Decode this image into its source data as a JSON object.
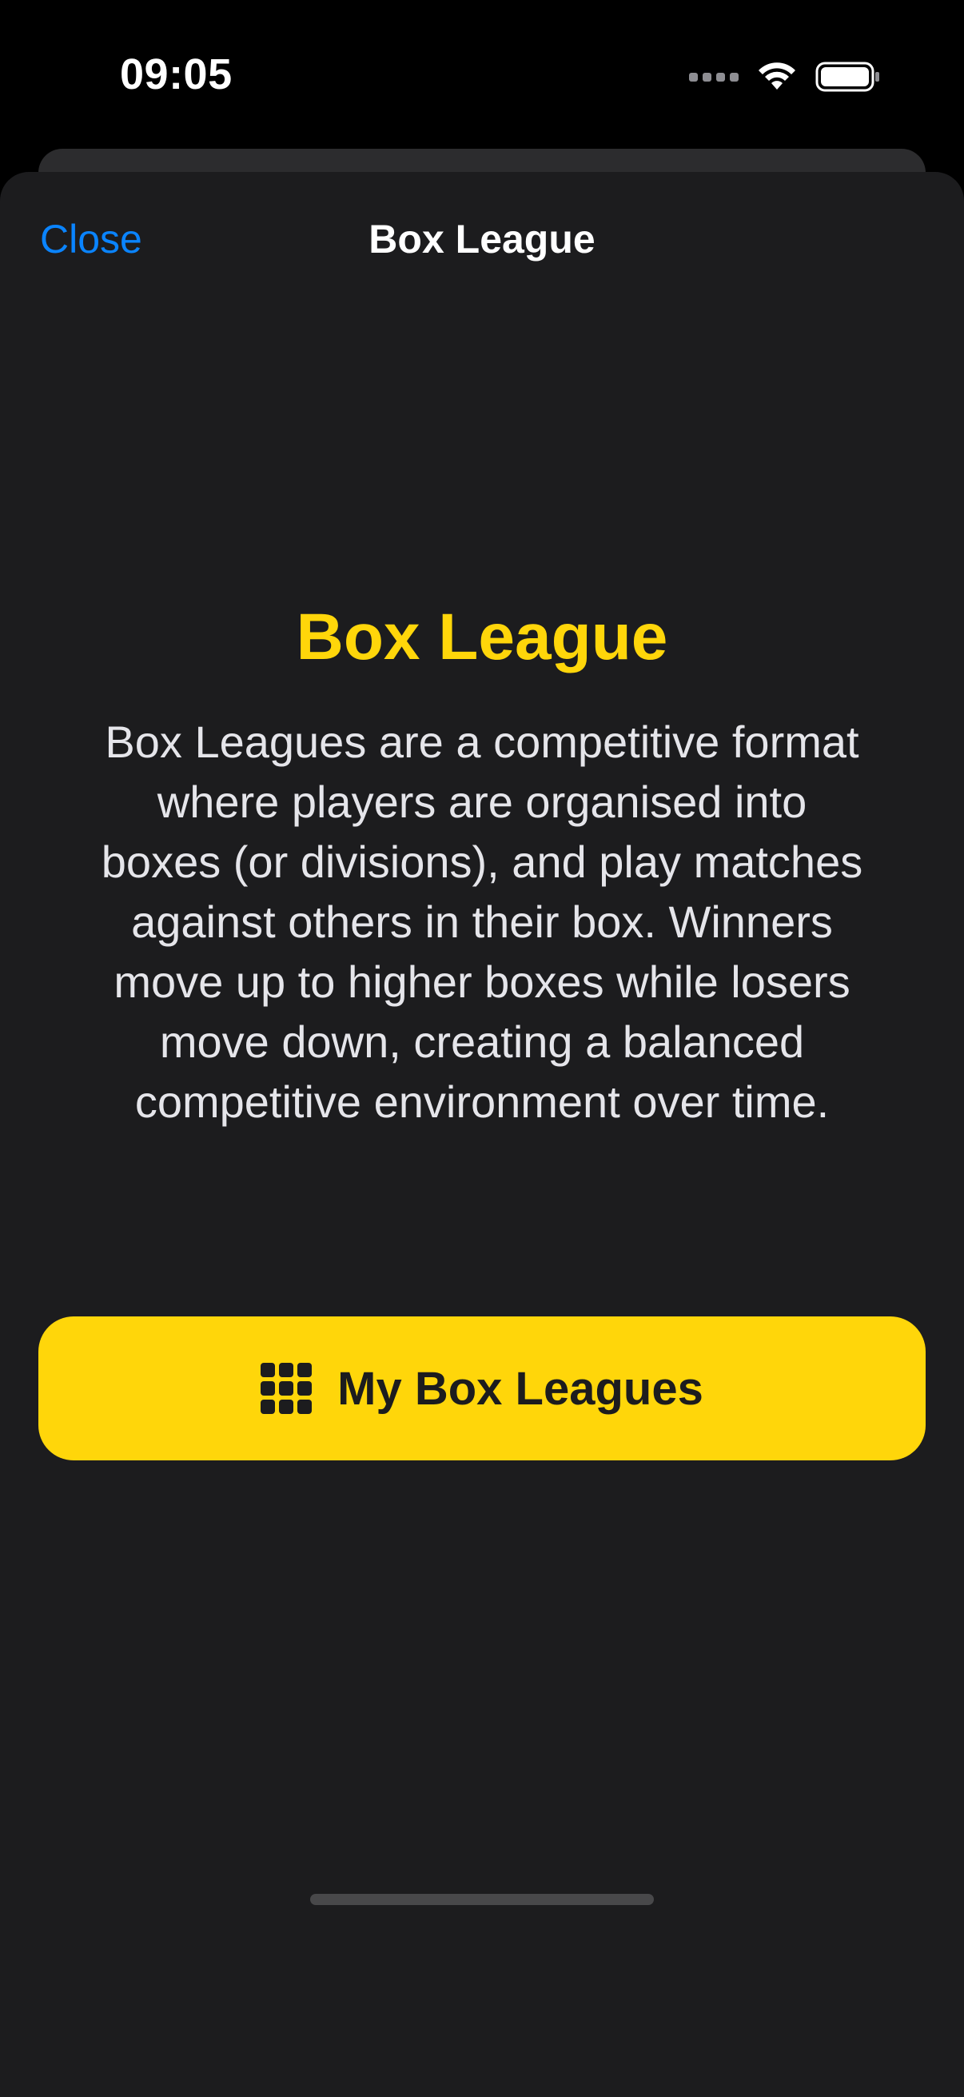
{
  "status_bar": {
    "time": "09:05"
  },
  "nav": {
    "close_label": "Close",
    "title": "Box League"
  },
  "content": {
    "heading": "Box League",
    "description": "Box Leagues are a competitive format where players are organised into boxes (or divisions), and play matches against others in their box. Winners move up to higher boxes while losers move down, creating a balanced competitive environment over time."
  },
  "primary_button": {
    "label": "My Box Leagues",
    "icon": "grid-icon"
  },
  "colors": {
    "accent_yellow": "#ffd60a",
    "link_blue": "#0a84ff",
    "sheet_background": "#1c1c1e",
    "screen_background": "#000000"
  }
}
